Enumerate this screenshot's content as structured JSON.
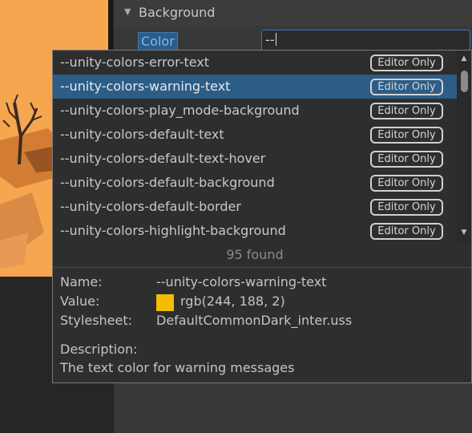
{
  "inspector": {
    "section_title": "Background",
    "field_label": "Color",
    "field_value": "--"
  },
  "popup": {
    "items": [
      {
        "name": "--unity-colors-error-text",
        "badge": "Editor Only",
        "selected": false
      },
      {
        "name": "--unity-colors-warning-text",
        "badge": "Editor Only",
        "selected": true
      },
      {
        "name": "--unity-colors-play_mode-background",
        "badge": "Editor Only",
        "selected": false
      },
      {
        "name": "--unity-colors-default-text",
        "badge": "Editor Only",
        "selected": false
      },
      {
        "name": "--unity-colors-default-text-hover",
        "badge": "Editor Only",
        "selected": false
      },
      {
        "name": "--unity-colors-default-background",
        "badge": "Editor Only",
        "selected": false
      },
      {
        "name": "--unity-colors-default-border",
        "badge": "Editor Only",
        "selected": false
      },
      {
        "name": "--unity-colors-highlight-background",
        "badge": "Editor Only",
        "selected": false
      }
    ],
    "found_text": "95 found",
    "details": {
      "name_label": "Name:",
      "name_value": "--unity-colors-warning-text",
      "value_label": "Value:",
      "value_text": "rgb(244, 188, 2)",
      "value_color": "#f4bc02",
      "stylesheet_label": "Stylesheet:",
      "stylesheet_value": "DefaultCommonDark_inter.uss",
      "description_label": "Description:",
      "description_text": "The text color for warning messages"
    }
  },
  "colors": {
    "selection": "#2c5d87",
    "scene_background": "#f5a64e"
  }
}
